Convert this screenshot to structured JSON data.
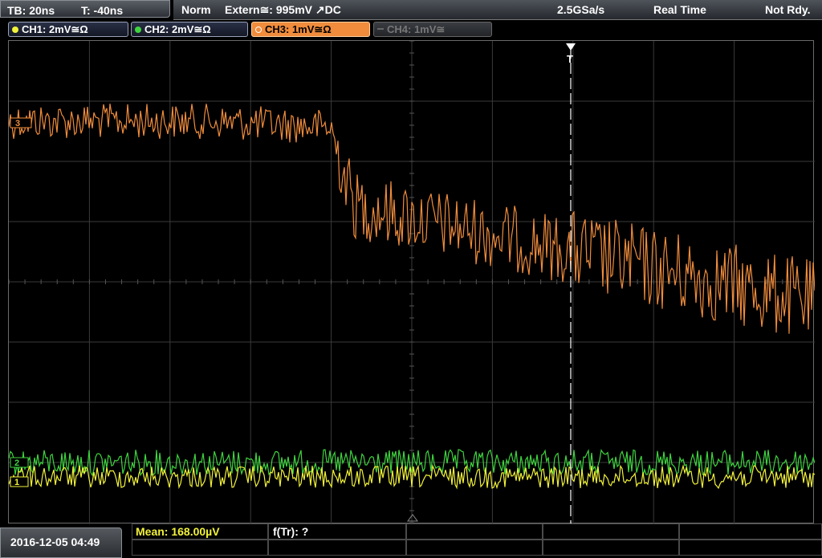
{
  "topbar": {
    "timebase": "TB: 20ns",
    "trigger_time": "T: -40ns",
    "acq_mode": "Norm",
    "trigger_source": "Extern≅: 995mV ↗DC",
    "sample_rate": "2.5GSa/s",
    "acq_type": "Real Time",
    "status": "Not Rdy."
  },
  "channels": [
    {
      "label": "CH1: 2mV≅Ω",
      "color": "#f2f23a"
    },
    {
      "label": "CH2: 2mV≅Ω",
      "color": "#3fd43f"
    },
    {
      "label": "CH3: 1mV≅Ω",
      "color": "#f08c3c"
    },
    {
      "label": "CH4: 1mV≅",
      "color": "#777777"
    }
  ],
  "markers": {
    "ch3": "3",
    "ch2": "2",
    "ch1": "1",
    "trigger": "T"
  },
  "bottom": {
    "datetime": "2016-12-05 04:49",
    "mean": "Mean: 168.00µV",
    "ftr": "f(Tr): ?"
  },
  "colors": {
    "ch1": "#f2f23a",
    "ch2": "#3fd43f",
    "ch3": "#f08c3c",
    "grid": "#3a3a3a",
    "mean_text": "#f2f23a"
  }
}
